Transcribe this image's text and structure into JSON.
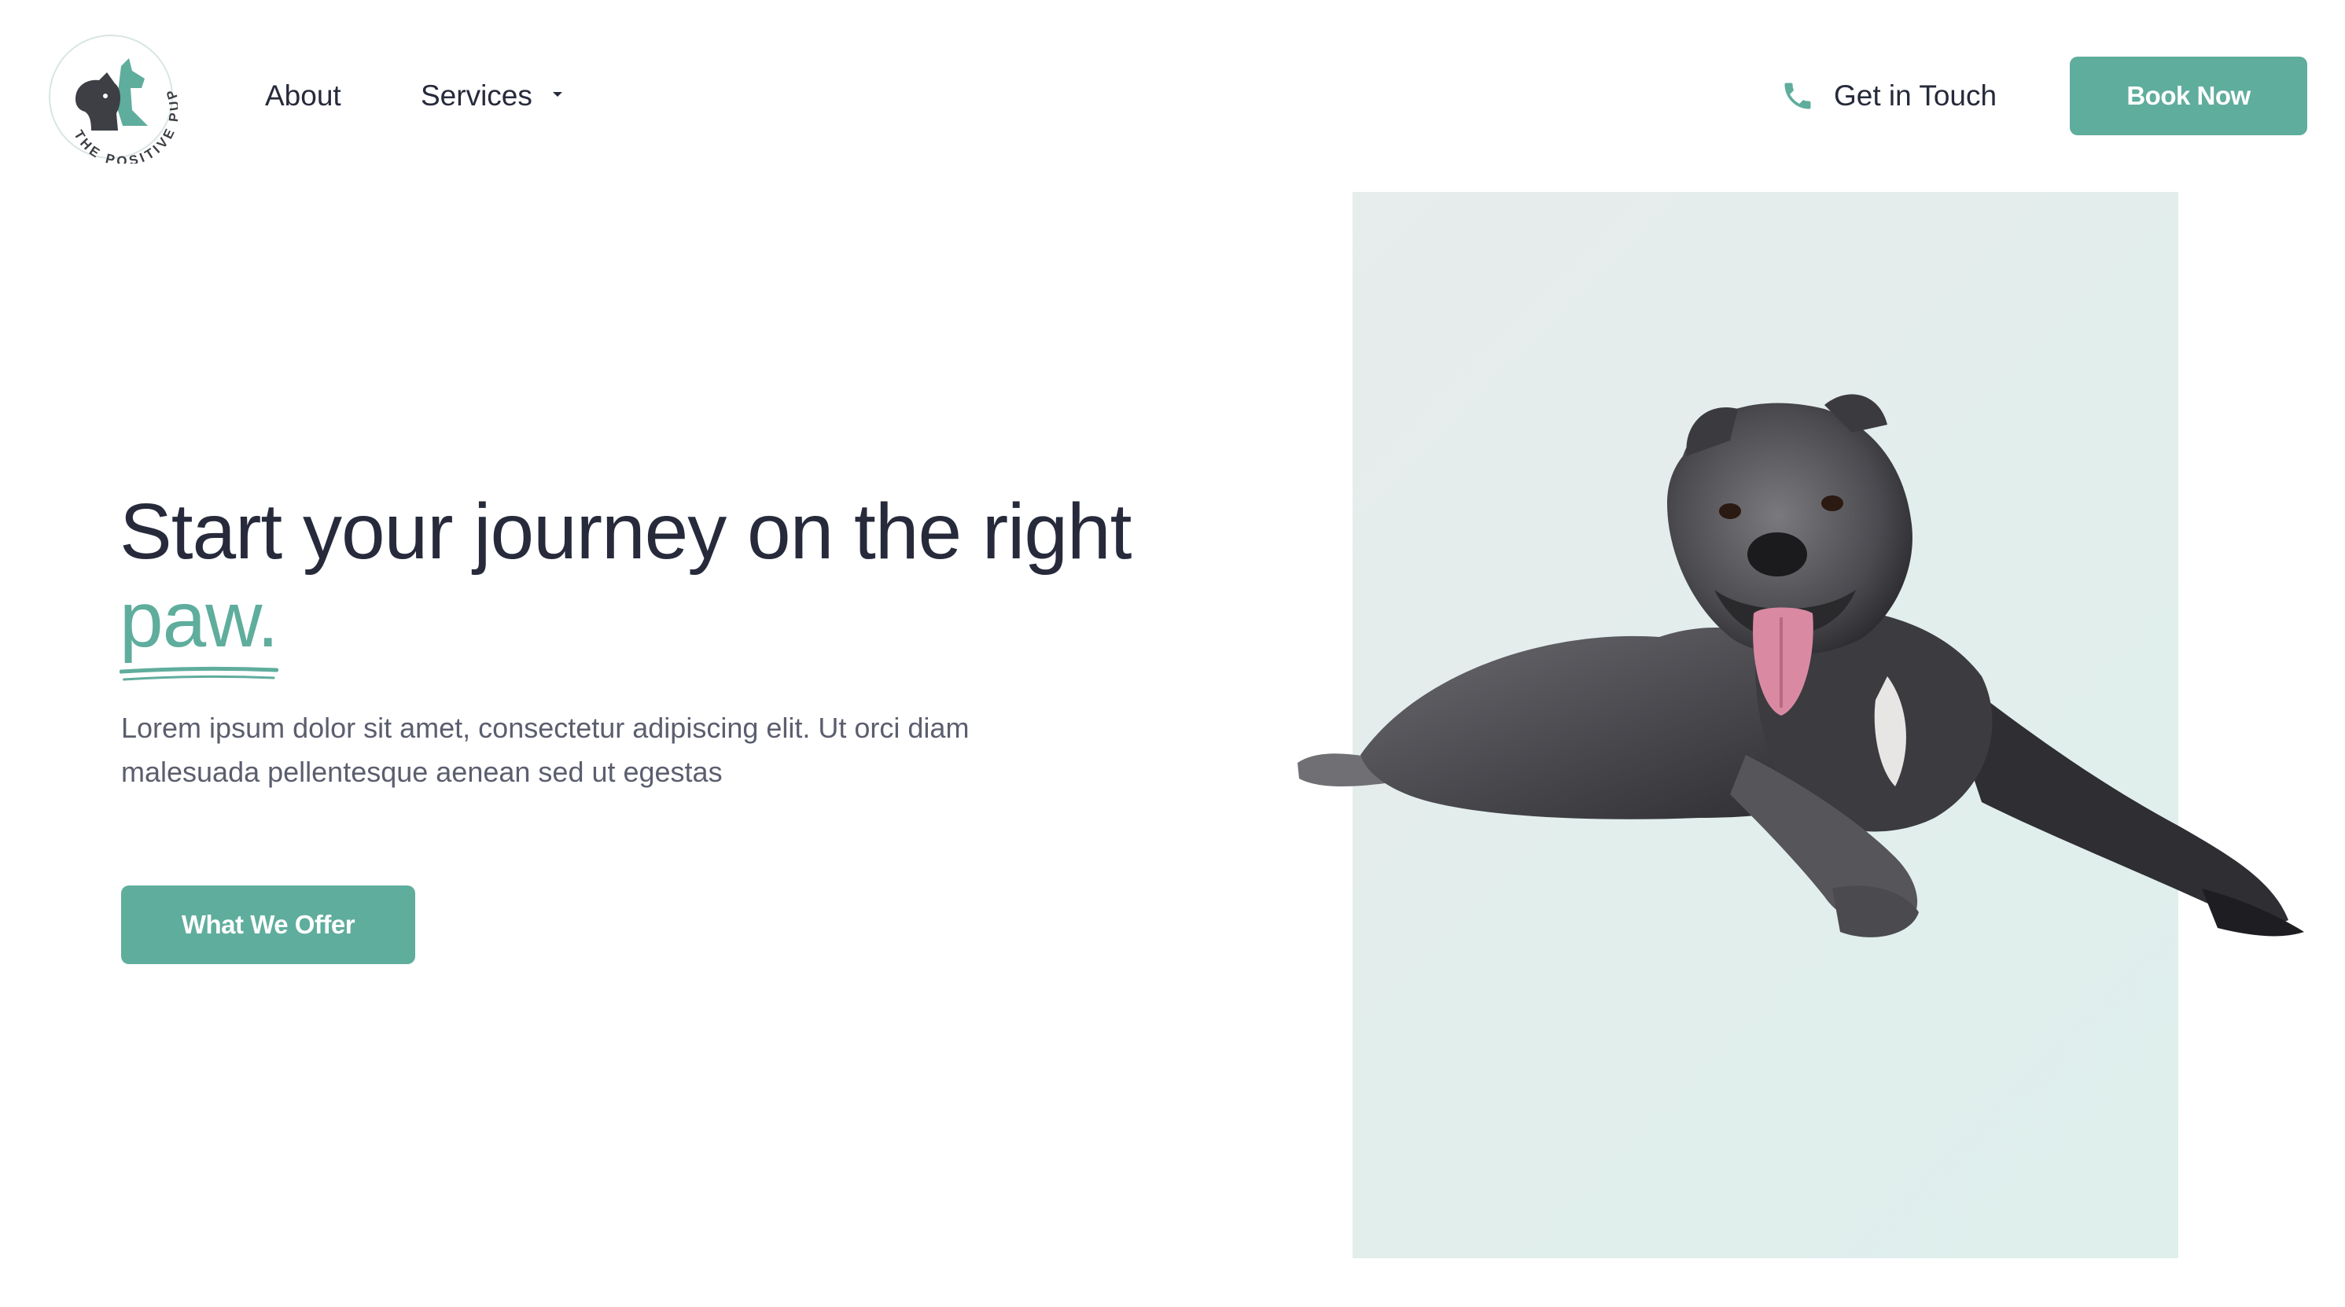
{
  "brand": {
    "logo_text": "THE POSITIVE PUP",
    "accent_color": "#5fad9d",
    "text_color": "#262a3b"
  },
  "nav": {
    "about": "About",
    "services": "Services",
    "services_icon": "chevron-down-icon"
  },
  "header": {
    "contact_label": "Get in Touch",
    "contact_icon": "phone-icon",
    "cta_label": "Book Now"
  },
  "hero": {
    "headline_part1": "Start your journey on the right",
    "headline_accent": "paw.",
    "lead": "Lorem ipsum dolor sit amet, consectetur adipiscing elit. Ut orci diam malesuada pellentesque aenean sed ut egestas",
    "cta_label": "What We Offer",
    "panel_color": "#e4eeec"
  }
}
